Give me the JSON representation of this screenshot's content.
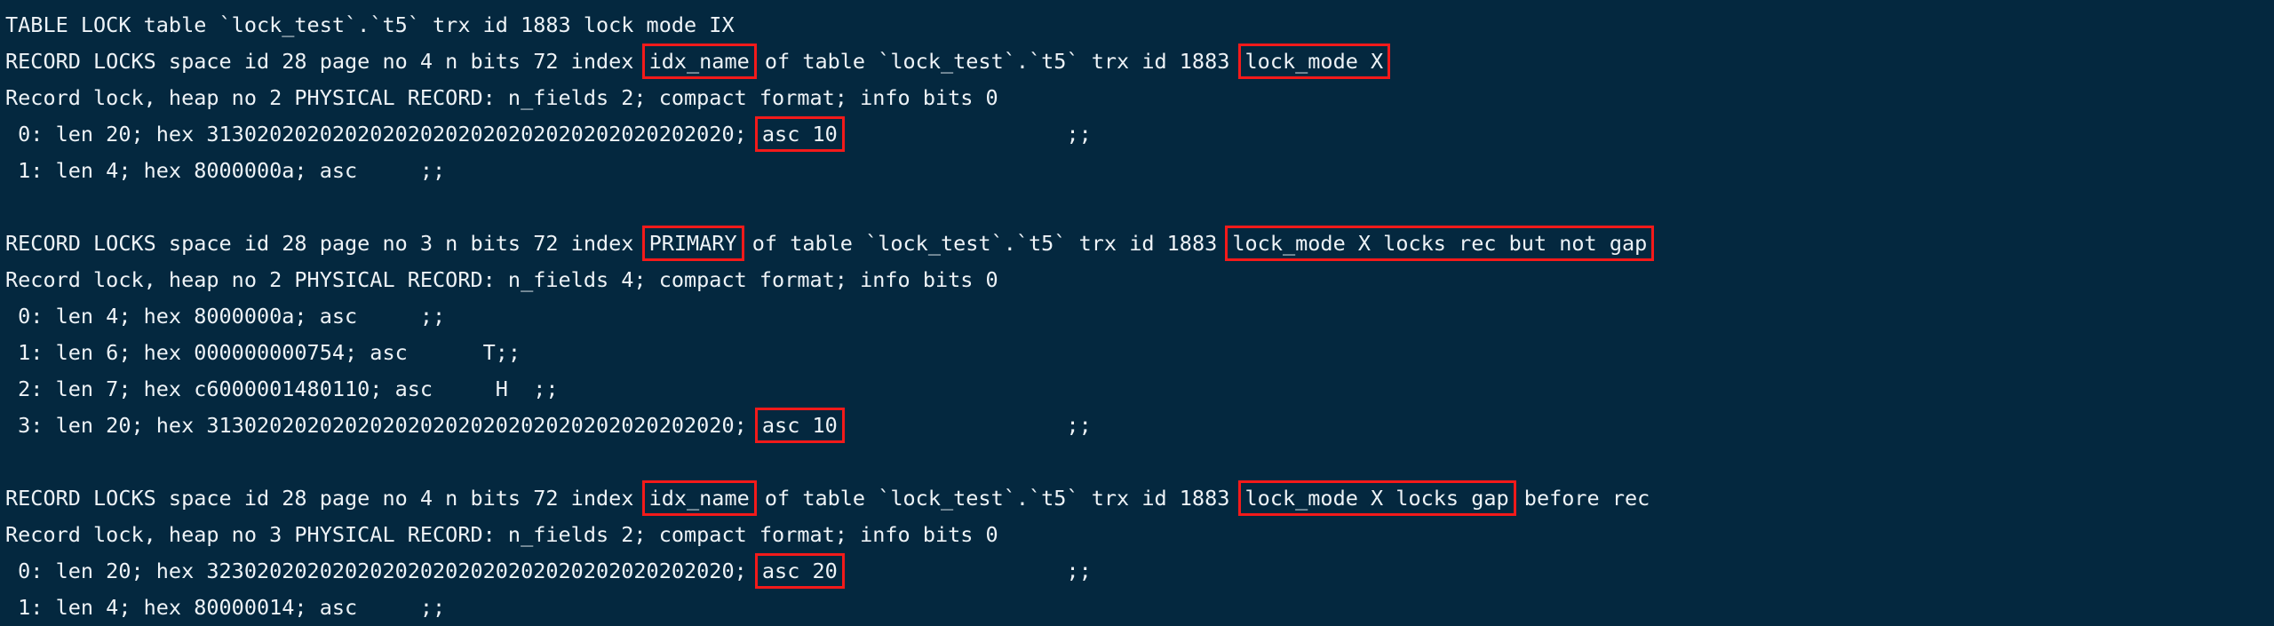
{
  "terminal": {
    "title": "InnoDB lock monitor output",
    "background_color": "#04283f",
    "text_color": "#eef3f7",
    "highlight_color": "#f41a1a",
    "lines": [
      {
        "id": "table-lock-line",
        "segments": [
          {
            "text": "TABLE LOCK table `lock_test`.`t5` trx id 1883 lock mode IX",
            "highlight": false
          }
        ]
      },
      {
        "id": "record-locks-line-1",
        "segments": [
          {
            "text": "RECORD LOCKS space id 28 page no 4 n bits 72 index ",
            "highlight": false
          },
          {
            "text": "idx_name",
            "highlight": true
          },
          {
            "text": " of table `lock_test`.`t5` trx id 1883 ",
            "highlight": false
          },
          {
            "text": "lock_mode X",
            "highlight": true
          }
        ]
      },
      {
        "id": "record-lock-heap-line-1",
        "segments": [
          {
            "text": "Record lock, heap no 2 PHYSICAL RECORD: n_fields 2; compact format; info bits 0",
            "highlight": false
          }
        ]
      },
      {
        "id": "field-line-1-0",
        "segments": [
          {
            "text": " 0: len 20; hex 313020202020202020202020202020202020202020; ",
            "highlight": false
          },
          {
            "text": "asc 10",
            "highlight": true
          },
          {
            "text": "                  ;;",
            "highlight": false
          }
        ]
      },
      {
        "id": "field-line-1-1",
        "segments": [
          {
            "text": " 1: len 4; hex 8000000a; asc     ;;",
            "highlight": false
          }
        ]
      },
      {
        "id": "blank-line-1",
        "segments": [
          {
            "text": "",
            "highlight": false
          }
        ]
      },
      {
        "id": "record-locks-line-2",
        "segments": [
          {
            "text": "RECORD LOCKS space id 28 page no 3 n bits 72 index ",
            "highlight": false
          },
          {
            "text": "PRIMARY",
            "highlight": true
          },
          {
            "text": " of table `lock_test`.`t5` trx id 1883 ",
            "highlight": false
          },
          {
            "text": "lock_mode X locks rec but not gap",
            "highlight": true
          }
        ]
      },
      {
        "id": "record-lock-heap-line-2",
        "segments": [
          {
            "text": "Record lock, heap no 2 PHYSICAL RECORD: n_fields 4; compact format; info bits 0",
            "highlight": false
          }
        ]
      },
      {
        "id": "field-line-2-0",
        "segments": [
          {
            "text": " 0: len 4; hex 8000000a; asc     ;;",
            "highlight": false
          }
        ]
      },
      {
        "id": "field-line-2-1",
        "segments": [
          {
            "text": " 1: len 6; hex 000000000754; asc      T;;",
            "highlight": false
          }
        ]
      },
      {
        "id": "field-line-2-2",
        "segments": [
          {
            "text": " 2: len 7; hex c6000001480110; asc     H  ;;",
            "highlight": false
          }
        ]
      },
      {
        "id": "field-line-2-3",
        "segments": [
          {
            "text": " 3: len 20; hex 313020202020202020202020202020202020202020; ",
            "highlight": false
          },
          {
            "text": "asc 10",
            "highlight": true
          },
          {
            "text": "                  ;;",
            "highlight": false
          }
        ]
      },
      {
        "id": "blank-line-2",
        "segments": [
          {
            "text": "",
            "highlight": false
          }
        ]
      },
      {
        "id": "record-locks-line-3",
        "segments": [
          {
            "text": "RECORD LOCKS space id 28 page no 4 n bits 72 index ",
            "highlight": false
          },
          {
            "text": "idx_name",
            "highlight": true
          },
          {
            "text": " of table `lock_test`.`t5` trx id 1883 ",
            "highlight": false
          },
          {
            "text": "lock_mode X locks gap",
            "highlight": true
          },
          {
            "text": " before rec",
            "highlight": false
          }
        ]
      },
      {
        "id": "record-lock-heap-line-3",
        "segments": [
          {
            "text": "Record lock, heap no 3 PHYSICAL RECORD: n_fields 2; compact format; info bits 0",
            "highlight": false
          }
        ]
      },
      {
        "id": "field-line-3-0",
        "segments": [
          {
            "text": " 0: len 20; hex 323020202020202020202020202020202020202020; ",
            "highlight": false
          },
          {
            "text": "asc 20",
            "highlight": true
          },
          {
            "text": "                  ;;",
            "highlight": false
          }
        ]
      },
      {
        "id": "field-line-3-1",
        "segments": [
          {
            "text": " 1: len 4; hex 80000014; asc     ;;",
            "highlight": false
          }
        ]
      }
    ]
  }
}
